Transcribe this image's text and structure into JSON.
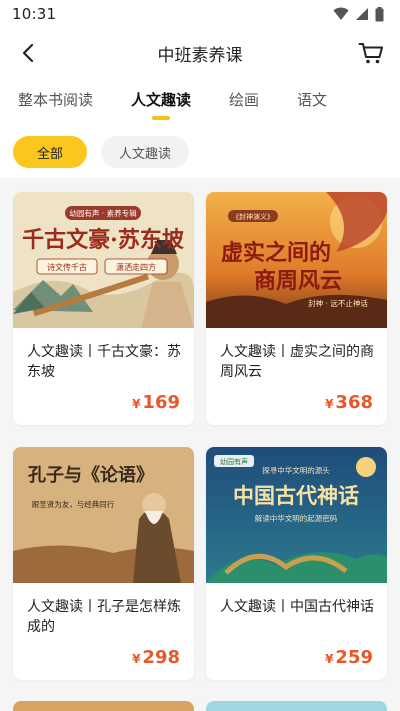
{
  "status_bar": {
    "time": "10:31"
  },
  "header": {
    "title": "中班素养课"
  },
  "tabs": [
    {
      "label": "整本书阅读"
    },
    {
      "label": "人文趣读"
    },
    {
      "label": "绘画"
    },
    {
      "label": "语文"
    }
  ],
  "filters": [
    {
      "label": "全部"
    },
    {
      "label": "人文趣读"
    }
  ],
  "courses": [
    {
      "title": "人文趣读丨千古文豪：苏东坡",
      "currency": "¥",
      "price": "169",
      "cover": {
        "brand": "幼园有声 · 素养专辑",
        "headline": "千古文豪·苏东坡",
        "tag1": "诗文传千古",
        "tag2": "潇洒走四方"
      }
    },
    {
      "title": "人文趣读丨虚实之间的商周风云",
      "currency": "¥",
      "price": "368",
      "cover": {
        "brand": "《封神演义》",
        "headline_line1": "虚实之间的",
        "headline_line2": "商周风云",
        "tag1": "封神 · 远不止神话"
      }
    },
    {
      "title": "人文趣读丨孔子是怎样炼成的",
      "currency": "¥",
      "price": "298",
      "cover": {
        "headline": "孔子与《论语》",
        "tag1": "跟圣贤为友，与经典同行"
      }
    },
    {
      "title": "人文趣读丨中国古代神话",
      "currency": "¥",
      "price": "259",
      "cover": {
        "brand": "幼园有声",
        "subtitle": "探寻中华文明的源头",
        "headline": "中国古代神话",
        "tag1": "解读中华文明的起源密码"
      }
    }
  ],
  "colors": {
    "accent": "#fbc61e",
    "price": "#e8582b",
    "background": "#f5f5f5"
  }
}
